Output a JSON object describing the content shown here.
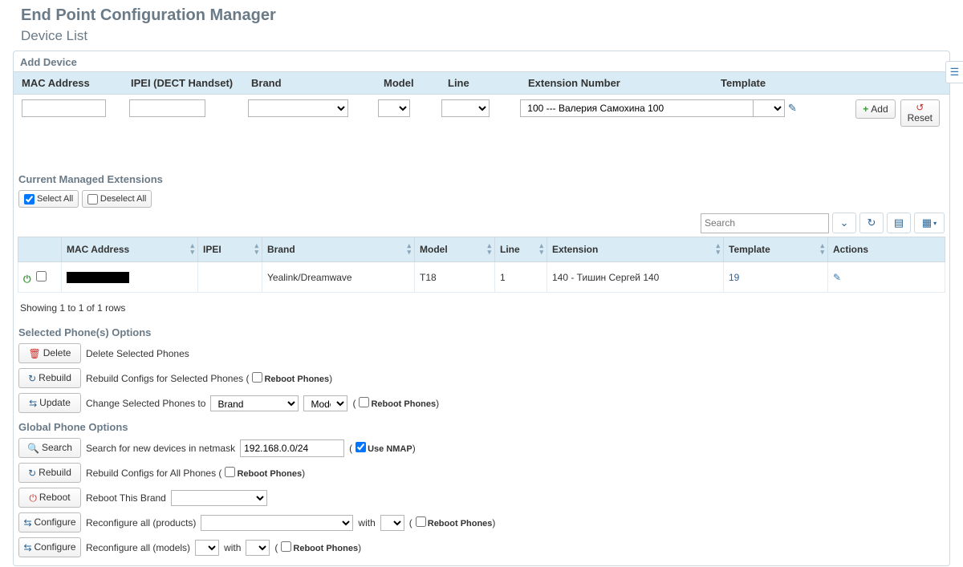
{
  "header": {
    "title": "End Point Configuration Manager",
    "subtitle": "Device List"
  },
  "add_device": {
    "heading": "Add Device",
    "cols": {
      "mac": "MAC Address",
      "ipei": "IPEI (DECT Handset)",
      "brand": "Brand",
      "model": "Model",
      "line": "Line",
      "ext": "Extension Number",
      "template": "Template"
    },
    "values": {
      "mac": "",
      "ipei": "",
      "brand": "",
      "model": "",
      "line": "",
      "ext_selected": "100 --- Валерия Самохина 100",
      "template": ""
    },
    "add_btn": "Add",
    "reset_btn": "Reset"
  },
  "managed": {
    "heading": "Current Managed Extensions",
    "select_all": "Select All",
    "deselect_all": "Deselect All",
    "search_placeholder": "Search",
    "cols": {
      "mac": "MAC Address",
      "ipei": "IPEI",
      "brand": "Brand",
      "model": "Model",
      "line": "Line",
      "ext": "Extension",
      "template": "Template",
      "actions": "Actions"
    },
    "row": {
      "brand": "Yealink/Dreamwave",
      "model": "T18",
      "line": "1",
      "ext": "140 - Тишин Сергей 140",
      "template": "19"
    },
    "showing": "Showing 1 to 1 of 1 rows"
  },
  "selected_opts_heading": "Selected Phone(s) Options",
  "global_opts_heading": "Global Phone Options",
  "opts": {
    "delete_btn": "Delete",
    "delete_lbl": "Delete Selected Phones",
    "rebuild_btn": "Rebuild",
    "rebuild_sel_lbl": "Rebuild Configs for Selected Phones (",
    "reboot_phones": "Reboot Phones",
    "update_btn": "Update",
    "update_lbl": "Change Selected Phones to",
    "brand_opt": "Brand",
    "model_opt": "Model",
    "search_btn": "Search",
    "search_lbl": "Search for new devices in netmask",
    "search_val": "192.168.0.0/24",
    "use_nmap": "Use NMAP",
    "rebuild_all_lbl": "Rebuild Configs for All Phones (",
    "reboot_btn": "Reboot",
    "reboot_lbl": "Reboot This Brand",
    "configure_btn": "Configure",
    "reconf_products": "Reconfigure all (products)",
    "reconf_models": "Reconfigure all (models)",
    "with": "with"
  }
}
